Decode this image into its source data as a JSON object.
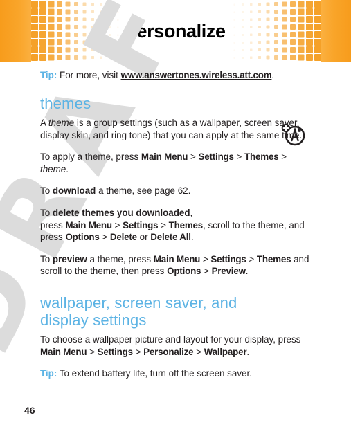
{
  "banner": {
    "title": "personalize",
    "accent_color": "#f79c1c",
    "square_color": "#f5a128"
  },
  "watermark": {
    "text": "DRAFT",
    "color": "#dcdcdc"
  },
  "heading_color": "#5cb3e4",
  "tip_top": {
    "label": "Tip:",
    "text_before": " For more, visit ",
    "url": "www.answertones.wireless.att.com",
    "text_after": "."
  },
  "themes_section": {
    "heading": "themes",
    "intro": {
      "p1": "A ",
      "italic1": "theme",
      "p2": " is a group settings (such as a wallpaper, screen saver, display skin, and ring tone) that you can apply at the same time."
    },
    "apply": {
      "lead": "To apply a theme, press ",
      "menu1": "Main Menu",
      "sep1": " > ",
      "menu2": "Settings",
      "sep2": " > ",
      "menu3": "Themes",
      "sep3": " > ",
      "italic_tail": "theme",
      "period": "."
    },
    "download": {
      "lead": "To ",
      "bold": "download",
      "tail": " a theme, see page 62."
    },
    "delete": {
      "lead": "To ",
      "bold": "delete themes you downloaded",
      "comma": ",",
      "line2_lead": "press ",
      "menu1": "Main Menu",
      "sep1": " > ",
      "menu2": "Settings",
      "sep2": " > ",
      "menu3": "Themes",
      "mid": ", scroll to the theme, and press ",
      "menu4": "Options",
      "sep3": " > ",
      "menu5": "Delete",
      "or": " or ",
      "menu6": "Delete All",
      "period": "."
    },
    "preview": {
      "lead": "To ",
      "bold": "preview",
      "mid1": " a theme, press ",
      "menu1": "Main Menu",
      "sep1": " > ",
      "menu2": "Settings",
      "sep2": " > ",
      "menu3": "Themes",
      "mid2": " and scroll to the theme, then press ",
      "menu4": "Options",
      "sep3": " > ",
      "menu5": "Preview",
      "period": "."
    }
  },
  "wallpaper_section": {
    "heading_line1": "wallpaper, screen saver, and",
    "heading_line2": "display settings",
    "choose": {
      "lead": "To choose a wallpaper picture and layout for your display, press ",
      "menu1": "Main Menu",
      "sep1": " > ",
      "menu2": "Settings",
      "sep2": " > ",
      "menu3": "Personalize",
      "sep3": " > ",
      "menu4": "Wallpaper",
      "period": "."
    },
    "tip": {
      "label": "Tip:",
      "text": " To extend battery life, turn off the screen saver."
    }
  },
  "side_icon": {
    "name": "antenna-tower-add-icon"
  },
  "footer": {
    "page_number": "46"
  }
}
